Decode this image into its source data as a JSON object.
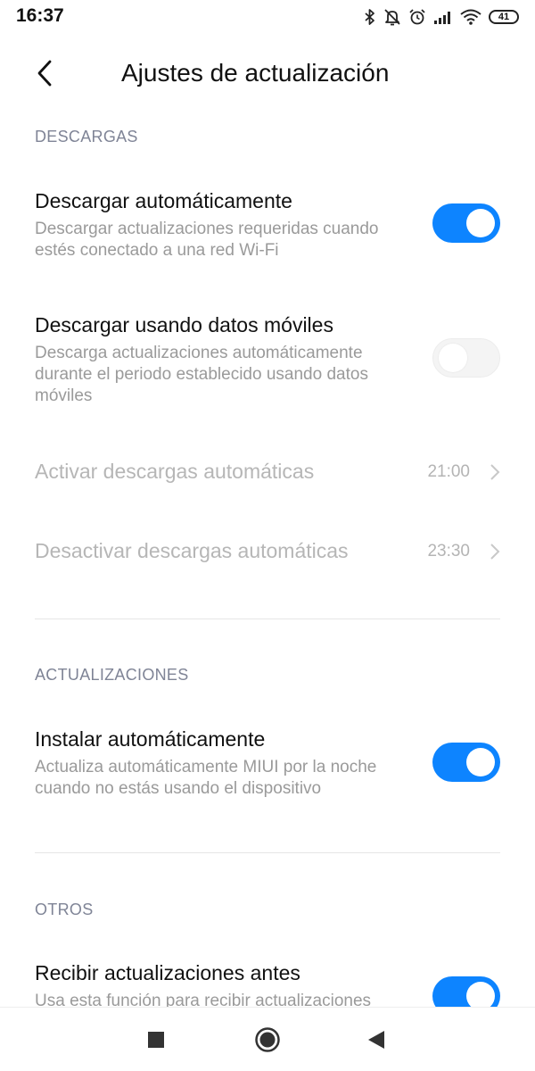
{
  "status_bar": {
    "time": "16:37",
    "battery": "41",
    "icons": [
      "bluetooth-icon",
      "mute-icon",
      "alarm-icon",
      "signal-icon",
      "wifi-icon",
      "battery-icon"
    ]
  },
  "header": {
    "title": "Ajustes de actualización",
    "back_icon": "chevron-left-icon"
  },
  "sections": {
    "descargas": {
      "header": "DESCARGAS",
      "auto_download": {
        "title": "Descargar automáticamente",
        "subtitle": "Descargar actualizaciones requeridas cuando estés conectado a una red Wi-Fi",
        "enabled": true
      },
      "mobile_data": {
        "title": "Descargar usando datos móviles",
        "subtitle": "Descarga actualizaciones automáticamente durante el periodo establecido usando datos móviles",
        "enabled": false
      },
      "activate_time": {
        "title": "Activar descargas automáticas",
        "value": "21:00"
      },
      "deactivate_time": {
        "title": "Desactivar descargas automáticas",
        "value": "23:30"
      }
    },
    "actualizaciones": {
      "header": "ACTUALIZACIONES",
      "auto_install": {
        "title": "Instalar automáticamente",
        "subtitle": "Actualiza automáticamente MIUI por la noche cuando no estás usando el dispositivo",
        "enabled": true
      }
    },
    "otros": {
      "header": "OTROS",
      "early_updates": {
        "title": "Recibir actualizaciones antes",
        "subtitle": "Usa esta función para recibir actualizaciones",
        "enabled": true
      }
    }
  },
  "nav_bar": {
    "icons": [
      "recents-square-icon",
      "home-circle-icon",
      "back-triangle-icon"
    ]
  },
  "colors": {
    "accent": "#0d84ff",
    "section_header": "#7f8496",
    "subtitle": "#9a9a9a",
    "disabled": "#b6b6b6"
  }
}
